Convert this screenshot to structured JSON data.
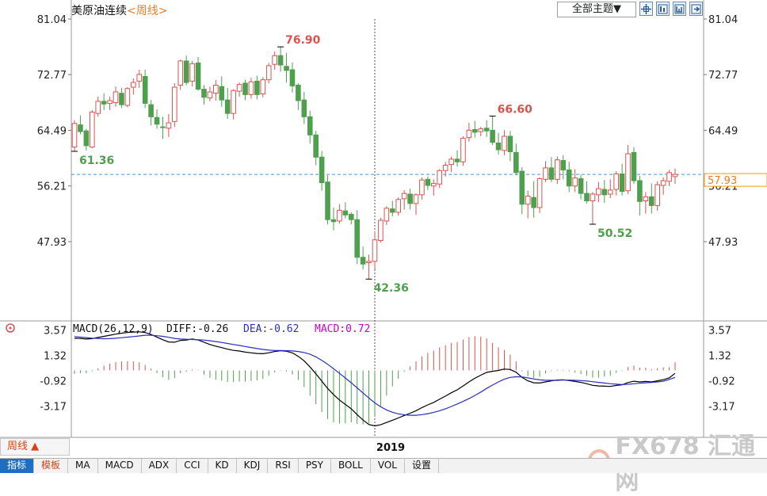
{
  "header": {
    "symbol": "美原油连续",
    "period_tag": "<周线>",
    "theme_label": "全部主题▼"
  },
  "toolbar_icons": [
    "crosshair-icon",
    "chart-type-icon",
    "indicator-icon",
    "exit-icon"
  ],
  "colors": {
    "up": "#d9534f",
    "down": "#4e9f4e",
    "diff": "#000000",
    "dea": "#2a2fbf",
    "macd": "#cc00cc",
    "label_up": "#d9534f",
    "label_down": "#4e9f4e",
    "price_line": "#4a90d9",
    "price_tag": "#f39c12"
  },
  "chart_data": {
    "type": "candlestick",
    "price_ticks": [
      "81.04",
      "72.77",
      "64.49",
      "56.21",
      "47.93"
    ],
    "macd_ticks": [
      "3.57",
      "1.32",
      "-0.92",
      "-3.17"
    ],
    "ylim": [
      38.5,
      81.04
    ],
    "macd_ylim": [
      -5.8,
      3.9
    ],
    "x_tick_label": "2019",
    "current_price": "57.93",
    "annotations": [
      {
        "text": "76.90",
        "kind": "high",
        "index": 35,
        "value": 76.9
      },
      {
        "text": "61.36",
        "kind": "low",
        "index": 0,
        "value": 61.36
      },
      {
        "text": "42.36",
        "kind": "low",
        "index": 50,
        "value": 42.36
      },
      {
        "text": "66.60",
        "kind": "high",
        "index": 71,
        "value": 66.6
      },
      {
        "text": "50.52",
        "kind": "low",
        "index": 88,
        "value": 50.52
      }
    ],
    "macd_legend": {
      "title": "MACD(26,12,9)",
      "diff": "DIFF:-0.26",
      "dea": "DEA:-0.62",
      "macd": "MACD:0.72"
    },
    "ohlc": [
      [
        62.0,
        66.0,
        61.36,
        65.5
      ],
      [
        65.3,
        66.7,
        63.9,
        64.3
      ],
      [
        64.4,
        64.7,
        61.5,
        62.2
      ],
      [
        62.0,
        67.5,
        61.8,
        67.2
      ],
      [
        67.0,
        69.5,
        66.5,
        68.8
      ],
      [
        68.8,
        70.0,
        67.5,
        68.4
      ],
      [
        68.5,
        69.5,
        67.5,
        68.9
      ],
      [
        68.6,
        71.0,
        68.0,
        70.2
      ],
      [
        70.0,
        70.8,
        67.8,
        68.3
      ],
      [
        68.2,
        70.9,
        67.9,
        70.7
      ],
      [
        70.9,
        72.2,
        69.8,
        71.6
      ],
      [
        71.8,
        73.5,
        70.8,
        72.8
      ],
      [
        72.5,
        73.5,
        67.8,
        68.5
      ],
      [
        68.3,
        69.0,
        65.2,
        66.5
      ],
      [
        66.4,
        67.6,
        64.7,
        65.4
      ],
      [
        65.0,
        66.5,
        63.2,
        64.9
      ],
      [
        64.8,
        66.9,
        63.5,
        65.6
      ],
      [
        65.8,
        71.5,
        65.0,
        70.9
      ],
      [
        71.2,
        75.0,
        70.5,
        74.8
      ],
      [
        74.8,
        75.6,
        71.2,
        71.6
      ],
      [
        71.8,
        74.8,
        71.0,
        74.4
      ],
      [
        74.5,
        75.4,
        70.4,
        70.6
      ],
      [
        70.6,
        71.2,
        68.3,
        69.4
      ],
      [
        69.3,
        71.0,
        68.8,
        70.2
      ],
      [
        70.0,
        72.0,
        68.9,
        71.2
      ],
      [
        71.0,
        72.5,
        68.0,
        69.0
      ],
      [
        69.0,
        70.8,
        66.2,
        67.0
      ],
      [
        67.0,
        70.6,
        66.1,
        70.4
      ],
      [
        70.3,
        71.6,
        69.5,
        71.3
      ],
      [
        71.5,
        72.0,
        69.0,
        69.8
      ],
      [
        69.8,
        72.3,
        69.2,
        71.7
      ],
      [
        71.8,
        72.6,
        69.1,
        69.8
      ],
      [
        69.9,
        72.4,
        69.4,
        72.0
      ],
      [
        72.0,
        74.5,
        71.5,
        74.1
      ],
      [
        74.3,
        76.2,
        73.5,
        75.6
      ],
      [
        75.6,
        76.9,
        73.2,
        74.2
      ],
      [
        74.0,
        76.0,
        71.6,
        73.4
      ],
      [
        73.5,
        74.6,
        70.1,
        71.1
      ],
      [
        71.2,
        71.5,
        67.5,
        68.9
      ],
      [
        69.0,
        70.2,
        65.4,
        66.5
      ],
      [
        66.5,
        67.4,
        62.5,
        63.8
      ],
      [
        63.8,
        64.4,
        59.3,
        60.5
      ],
      [
        60.5,
        61.4,
        55.5,
        56.7
      ],
      [
        56.8,
        57.8,
        50.5,
        51.2
      ],
      [
        51.2,
        53.0,
        49.6,
        50.9
      ],
      [
        51.0,
        53.5,
        50.6,
        52.6
      ],
      [
        52.5,
        53.8,
        51.4,
        51.9
      ],
      [
        52.0,
        52.3,
        50.5,
        51.2
      ],
      [
        51.2,
        52.6,
        44.6,
        45.6
      ],
      [
        45.6,
        47.2,
        43.8,
        44.6
      ],
      [
        44.8,
        46.0,
        42.36,
        45.0
      ],
      [
        45.0,
        49.5,
        43.8,
        48.2
      ],
      [
        48.1,
        51.5,
        47.8,
        51.1
      ],
      [
        51.0,
        53.2,
        50.4,
        52.9
      ],
      [
        52.8,
        54.0,
        51.7,
        52.3
      ],
      [
        52.3,
        54.5,
        51.8,
        54.2
      ],
      [
        54.3,
        55.6,
        52.7,
        55.1
      ],
      [
        55.0,
        55.8,
        52.7,
        53.6
      ],
      [
        53.6,
        55.1,
        51.9,
        54.9
      ],
      [
        54.9,
        57.5,
        54.2,
        57.1
      ],
      [
        57.2,
        57.6,
        55.6,
        56.3
      ],
      [
        56.2,
        57.2,
        54.8,
        56.6
      ],
      [
        56.5,
        58.7,
        55.9,
        58.5
      ],
      [
        58.5,
        59.8,
        57.6,
        59.3
      ],
      [
        59.4,
        60.6,
        58.3,
        60.2
      ],
      [
        60.2,
        61.5,
        59.1,
        59.8
      ],
      [
        59.8,
        63.6,
        59.2,
        63.3
      ],
      [
        63.4,
        65.6,
        62.8,
        64.5
      ],
      [
        64.6,
        65.9,
        63.4,
        64.2
      ],
      [
        64.3,
        65.0,
        63.6,
        64.7
      ],
      [
        64.8,
        66.0,
        63.5,
        64.4
      ],
      [
        64.5,
        66.6,
        62.3,
        62.7
      ],
      [
        62.6,
        64.1,
        60.9,
        61.6
      ],
      [
        61.5,
        64.5,
        60.8,
        63.6
      ],
      [
        63.6,
        64.4,
        59.9,
        61.3
      ],
      [
        61.2,
        62.5,
        57.8,
        58.2
      ],
      [
        58.4,
        59.0,
        52.0,
        53.5
      ],
      [
        53.5,
        55.5,
        51.4,
        54.7
      ],
      [
        54.5,
        56.9,
        51.5,
        53.0
      ],
      [
        53.0,
        57.5,
        52.2,
        57.3
      ],
      [
        57.2,
        59.9,
        56.8,
        58.9
      ],
      [
        58.9,
        60.5,
        56.8,
        57.2
      ],
      [
        57.2,
        60.6,
        56.5,
        60.1
      ],
      [
        60.0,
        60.8,
        57.2,
        58.6
      ],
      [
        58.6,
        59.8,
        55.3,
        56.2
      ],
      [
        56.2,
        58.7,
        55.3,
        57.4
      ],
      [
        57.3,
        57.9,
        54.2,
        55.1
      ],
      [
        55.1,
        56.9,
        53.6,
        54.0
      ],
      [
        54.0,
        55.3,
        50.52,
        55.0
      ],
      [
        54.9,
        56.8,
        53.8,
        55.8
      ],
      [
        55.7,
        57.1,
        53.7,
        54.9
      ],
      [
        55.0,
        57.2,
        54.4,
        55.6
      ],
      [
        55.7,
        58.4,
        54.8,
        58.0
      ],
      [
        58.0,
        59.5,
        54.8,
        55.4
      ],
      [
        55.5,
        62.3,
        55.0,
        61.0
      ],
      [
        61.2,
        62.0,
        56.5,
        57.0
      ],
      [
        57.0,
        57.7,
        51.8,
        53.9
      ],
      [
        54.0,
        55.3,
        52.1,
        54.6
      ],
      [
        54.6,
        56.6,
        52.1,
        53.3
      ],
      [
        53.3,
        56.9,
        52.5,
        56.4
      ],
      [
        56.3,
        57.5,
        54.9,
        57.0
      ],
      [
        56.9,
        58.6,
        56.2,
        58.2
      ],
      [
        57.6,
        58.8,
        56.5,
        57.93
      ]
    ],
    "diff": [
      2.85,
      2.83,
      2.78,
      2.82,
      2.92,
      3.02,
      3.12,
      3.22,
      3.3,
      3.36,
      3.4,
      3.42,
      3.36,
      3.2,
      2.96,
      2.72,
      2.52,
      2.5,
      2.66,
      2.7,
      2.78,
      2.7,
      2.5,
      2.3,
      2.15,
      2.02,
      1.88,
      1.78,
      1.72,
      1.62,
      1.56,
      1.5,
      1.48,
      1.56,
      1.68,
      1.74,
      1.7,
      1.55,
      1.25,
      0.85,
      0.3,
      -0.3,
      -0.95,
      -1.6,
      -2.15,
      -2.62,
      -3.02,
      -3.4,
      -3.92,
      -4.4,
      -4.8,
      -4.92,
      -4.82,
      -4.62,
      -4.42,
      -4.22,
      -4.0,
      -3.8,
      -3.58,
      -3.3,
      -3.06,
      -2.84,
      -2.56,
      -2.28,
      -1.98,
      -1.72,
      -1.38,
      -1.02,
      -0.7,
      -0.42,
      -0.18,
      -0.08,
      0.0,
      0.12,
      0.08,
      -0.16,
      -0.62,
      -0.92,
      -1.1,
      -1.12,
      -1.02,
      -0.92,
      -0.85,
      -0.83,
      -0.9,
      -0.98,
      -1.06,
      -1.18,
      -1.32,
      -1.38,
      -1.4,
      -1.42,
      -1.33,
      -1.28,
      -1.08,
      -0.96,
      -1.02,
      -0.98,
      -1.02,
      -0.92,
      -0.82,
      -0.66,
      -0.26
    ],
    "dea": [
      3.0,
      2.95,
      2.91,
      2.86,
      2.83,
      2.81,
      2.82,
      2.85,
      2.9,
      2.95,
      3.0,
      3.06,
      3.12,
      3.12,
      3.08,
      3.02,
      2.94,
      2.84,
      2.78,
      2.76,
      2.74,
      2.72,
      2.69,
      2.63,
      2.56,
      2.48,
      2.39,
      2.3,
      2.21,
      2.12,
      2.03,
      1.94,
      1.86,
      1.8,
      1.77,
      1.76,
      1.75,
      1.73,
      1.68,
      1.59,
      1.43,
      1.2,
      0.9,
      0.55,
      0.15,
      -0.26,
      -0.67,
      -1.1,
      -1.55,
      -2.0,
      -2.45,
      -2.88,
      -3.23,
      -3.51,
      -3.71,
      -3.85,
      -3.94,
      -3.98,
      -3.98,
      -3.92,
      -3.84,
      -3.72,
      -3.58,
      -3.4,
      -3.2,
      -2.98,
      -2.75,
      -2.5,
      -2.22,
      -1.92,
      -1.6,
      -1.3,
      -1.02,
      -0.78,
      -0.62,
      -0.56,
      -0.58,
      -0.66,
      -0.76,
      -0.84,
      -0.88,
      -0.88,
      -0.88,
      -0.86,
      -0.86,
      -0.88,
      -0.9,
      -0.94,
      -1.0,
      -1.06,
      -1.12,
      -1.18,
      -1.22,
      -1.25,
      -1.23,
      -1.18,
      -1.14,
      -1.1,
      -1.07,
      -1.02,
      -0.96,
      -0.8,
      -0.62
    ]
  },
  "tabs": [
    {
      "label": "指标",
      "style": "active"
    },
    {
      "label": "模板",
      "style": "template"
    },
    {
      "label": "MA",
      "style": ""
    },
    {
      "label": "MACD",
      "style": ""
    },
    {
      "label": "ADX",
      "style": ""
    },
    {
      "label": "CCI",
      "style": ""
    },
    {
      "label": "KD",
      "style": ""
    },
    {
      "label": "KDJ",
      "style": ""
    },
    {
      "label": "RSI",
      "style": ""
    },
    {
      "label": "PSY",
      "style": ""
    },
    {
      "label": "BOLL",
      "style": ""
    },
    {
      "label": "VOL",
      "style": ""
    },
    {
      "label": "设置",
      "style": ""
    }
  ],
  "period_selector": "周线 ▲",
  "watermark": "FX678 汇通网"
}
